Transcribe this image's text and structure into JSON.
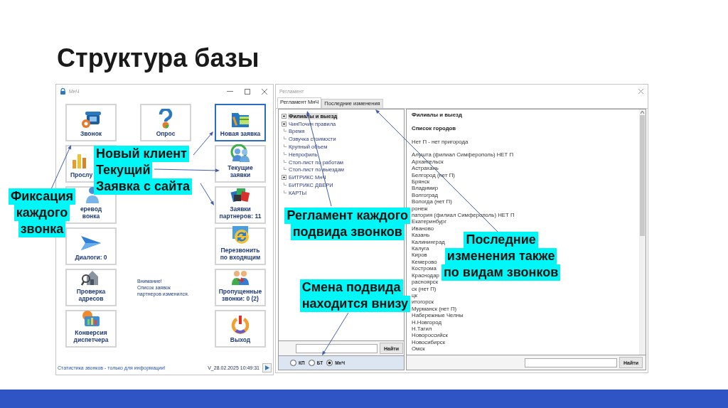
{
  "slide": {
    "title": "Структура базы"
  },
  "main_window": {
    "title": "МнЧ",
    "left_buttons": [
      {
        "label": "Звонок",
        "selected": false
      },
      {
        "label": "Прослу",
        "selected": false
      },
      {
        "label": "еревод\nвонка",
        "selected": false
      },
      {
        "label": "Диалоги: 0",
        "selected": false
      },
      {
        "label": "Проверка\nадресов",
        "selected": false
      },
      {
        "label": "Конверсия\nдиспетчера",
        "selected": false
      }
    ],
    "center_button": {
      "label": "Опрос",
      "selected": false
    },
    "notice": "Внимание!\nСписок заявок\nпартнеров изменился.",
    "right_buttons": [
      {
        "label": "Новая заявка",
        "selected": true
      },
      {
        "label": "Текущие\nзаявки",
        "selected": false
      },
      {
        "label": "Заявки\nпартнеров: 11",
        "selected": false
      },
      {
        "label": "Перезвонить\nпо входящим",
        "selected": false
      },
      {
        "label": "Пропущенные\nзвонки: 0 (2)",
        "selected": false
      },
      {
        "label": "Выход",
        "selected": false
      }
    ],
    "status": "Статистика звонков - только для информации!",
    "version": "V_28.02.2025 10:49:31"
  },
  "reglament_window": {
    "title": "Регламент",
    "tabs": [
      {
        "label": "Регламент МнЧ",
        "selected": true
      },
      {
        "label": "Последние изменения",
        "selected": false
      }
    ],
    "tree": [
      {
        "label": "Филиалы и выезд",
        "kind": "folder",
        "selected": true
      },
      {
        "label": "ЧинПочин правила",
        "kind": "folder",
        "selected": false
      },
      {
        "label": "Время",
        "kind": "leaf",
        "selected": false
      },
      {
        "label": "Озвучка стоимости",
        "kind": "leaf",
        "selected": false
      },
      {
        "label": "Крупный объем",
        "kind": "leaf",
        "selected": false
      },
      {
        "label": "Непрофиль",
        "kind": "leaf",
        "selected": false
      },
      {
        "label": "Стоп-лист по работам",
        "kind": "leaf",
        "selected": false
      },
      {
        "label": "Стоп-лист по выездам",
        "kind": "leaf",
        "selected": false
      },
      {
        "label": "БИТРИКС МнЧ",
        "kind": "folder",
        "selected": false
      },
      {
        "label": "БИТРИКС ДВЕРИ",
        "kind": "leaf",
        "selected": false
      },
      {
        "label": "КАРТЫ",
        "kind": "leaf",
        "selected": false
      }
    ],
    "tree_search_button": "Найти",
    "radios": [
      {
        "label": "КП",
        "selected": false
      },
      {
        "label": "БТ",
        "selected": false
      },
      {
        "label": "МнЧ",
        "selected": true
      }
    ],
    "document": [
      {
        "kind": "heading",
        "lines": [
          "Филиалы и выезд"
        ]
      },
      {
        "kind": "heading",
        "lines": [
          "Список городов"
        ]
      },
      {
        "kind": "text",
        "lines": [
          "Нет П - нет пригорода"
        ]
      },
      {
        "kind": "text",
        "lines": [
          "Алушта (филиал Симферополь) НЕТ П",
          "Архангельск",
          "Астрахань",
          "Белгород (нет П)",
          "Брянск",
          "Владимир",
          "Волгоград",
          "Вологда (нет П)",
          "ронеж",
          "патория (филиал Симферополь) НЕТ П",
          "Екатеринбург",
          "Иваново",
          "Казань",
          "Калининград",
          "Калуга",
          "Киров",
          "Кемерово",
          "Кострома",
          "Краснодар",
          "расноярск",
          "ск (нет П)",
          "цк",
          "итогорск",
          "Мурманск (нет П)",
          "Набережные Челны",
          "Н.Новгород",
          "Н.Тагил",
          "Новороссийск",
          "Новосибирск",
          "Омск"
        ]
      }
    ],
    "document_search_button": "Найти"
  },
  "callouts": [
    {
      "lines": [
        "Новый клиент",
        "Текущий",
        "Заявка с сайта"
      ]
    },
    {
      "lines": [
        "Фиксация",
        "каждого",
        "звонка"
      ]
    },
    {
      "lines": [
        "Регламент каждого",
        "подвида звонков"
      ]
    },
    {
      "lines": [
        "Последние",
        "изменения также",
        "по видам звонков"
      ]
    },
    {
      "lines": [
        "Смена подвида",
        "находится внизу"
      ]
    }
  ]
}
